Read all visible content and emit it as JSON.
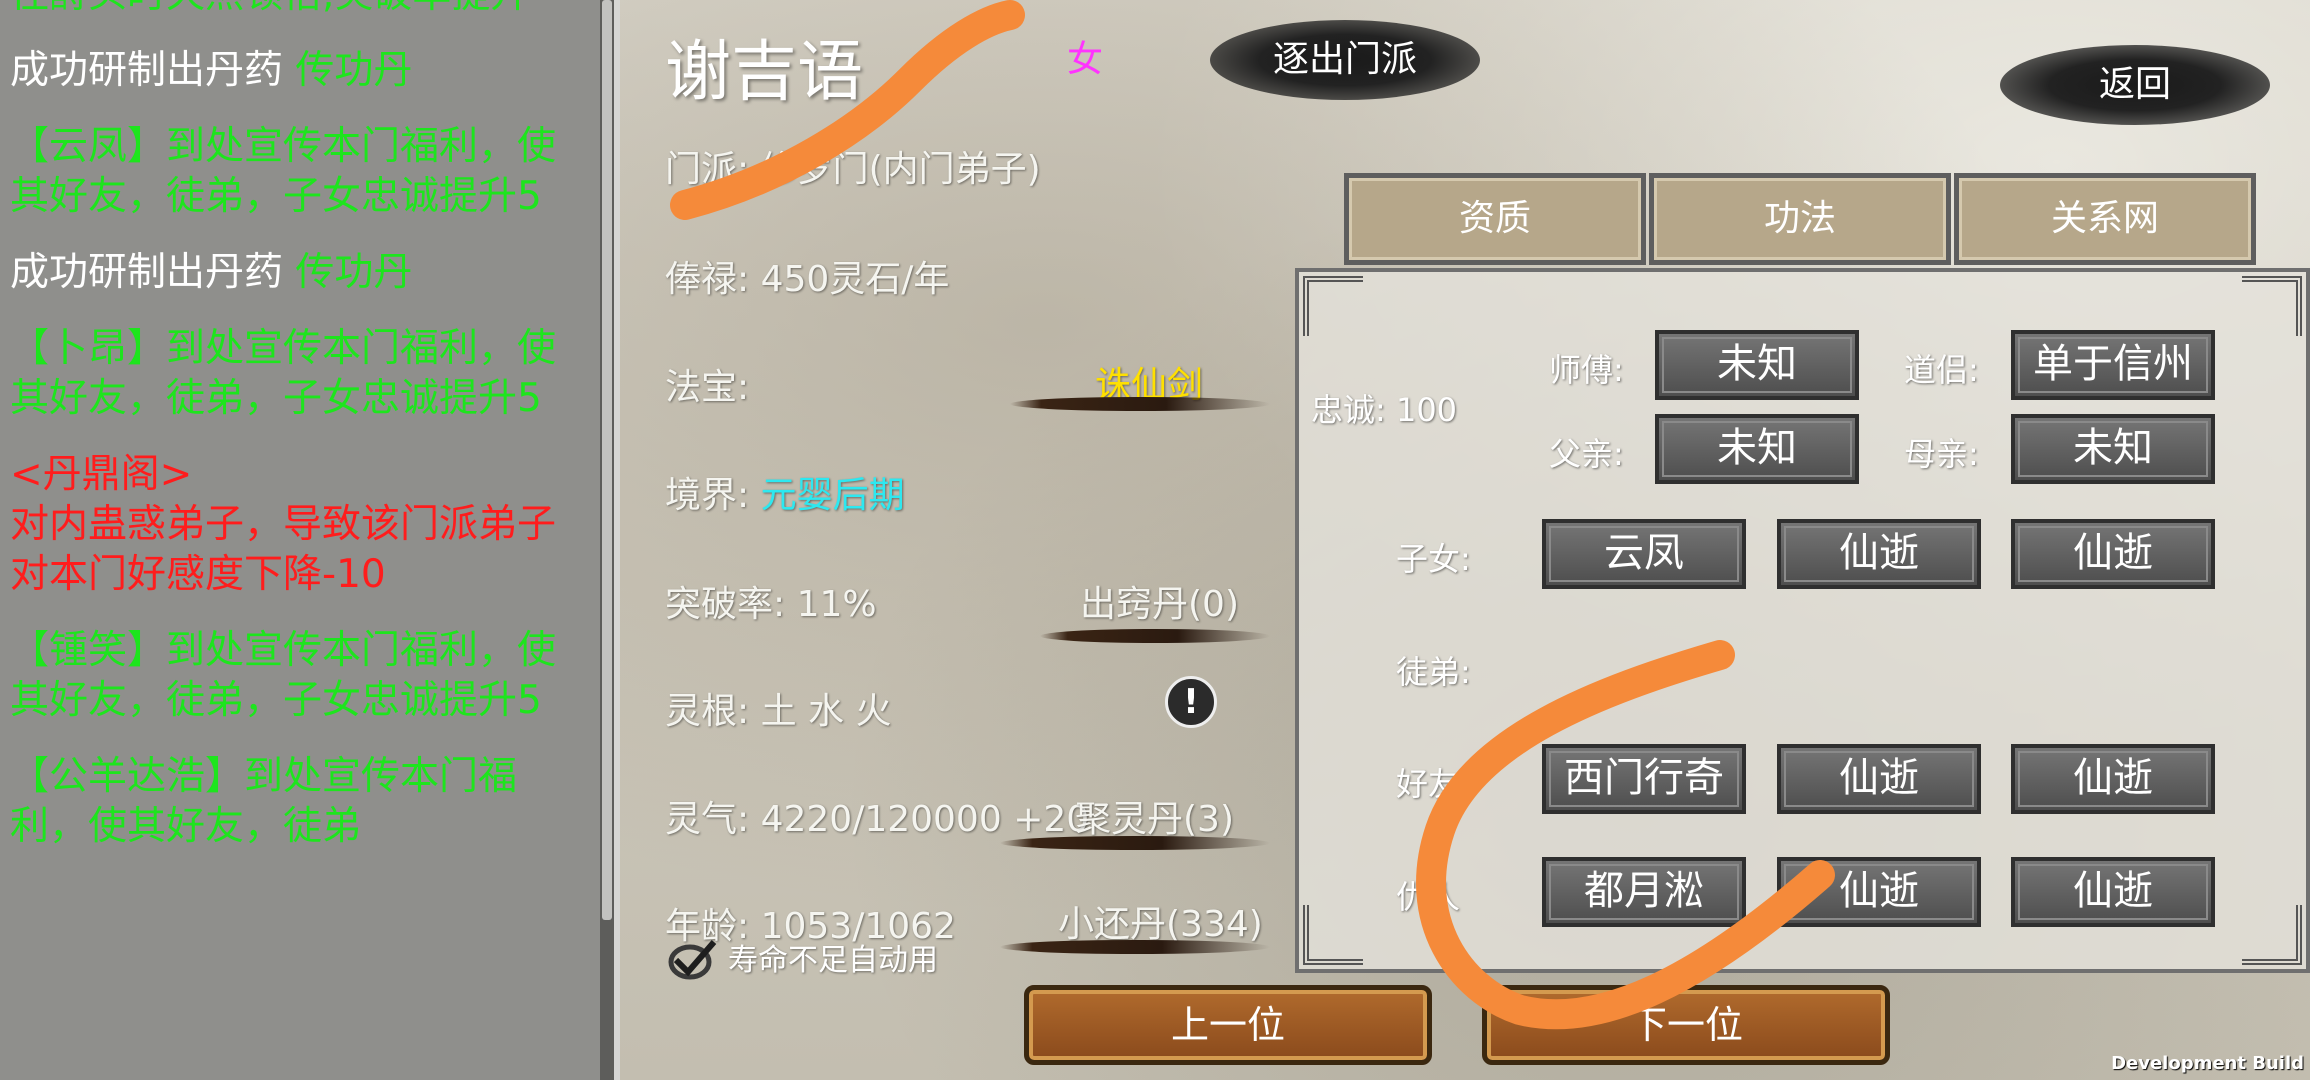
{
  "log": [
    {
      "parts": [
        {
          "text": "往酹头时天然顿悟,突破率提升",
          "color": "green"
        }
      ]
    },
    {
      "parts": [
        {
          "text": "成功研制出丹药 ",
          "color": "white"
        },
        {
          "text": "传功丹",
          "color": "green"
        }
      ]
    },
    {
      "parts": [
        {
          "text": "【云凤】到处宣传本门福利，使其好友，徒弟，子女忠诚提升5",
          "color": "green"
        }
      ]
    },
    {
      "parts": [
        {
          "text": "成功研制出丹药 ",
          "color": "white"
        },
        {
          "text": "传功丹",
          "color": "green"
        }
      ]
    },
    {
      "parts": [
        {
          "text": "【卜昂】到处宣传本门福利，使其好友，徒弟，子女忠诚提升5",
          "color": "green"
        }
      ]
    },
    {
      "parts": [
        {
          "text": "<丹鼎阁>",
          "color": "red"
        },
        {
          "text": "对内蛊惑弟子，导致该门派弟子对本门好感度下降-10",
          "color": "red"
        }
      ]
    },
    {
      "parts": [
        {
          "text": "【锺笑】到处宣传本门福利，使其好友，徒弟，子女忠诚提升5",
          "color": "green"
        }
      ]
    },
    {
      "parts": [
        {
          "text": "【公羊达浩】到处宣传本门福利，使其好友，徒弟",
          "color": "green"
        }
      ]
    }
  ],
  "character": {
    "name": "谢吉语",
    "gender": "女",
    "expel_label": "逐出门派",
    "back_label": "返回",
    "sect_label": "门派: ",
    "sect_value": "修罗门(内门弟子)",
    "salary_label": "俸禄: ",
    "salary_value": "450灵石/年",
    "treasure_label": "法宝:",
    "treasure_value": "诛仙剑",
    "realm_label": "境界: ",
    "realm_value": "元婴后期",
    "breakthrough_label": "突破率:  11%",
    "breakthrough_pill": "出窍丹(0)",
    "root_label": "灵根: 土 水 火",
    "qi_label": "灵气: 4220/120000 +20",
    "qi_pill": "聚灵丹(3)",
    "age_label": "年龄: 1053/1062",
    "age_pill": "小还丹(334)",
    "auto_use_label": "寿命不足自动用"
  },
  "tabs": [
    "资质",
    "功法",
    "关系网"
  ],
  "relations": {
    "loyalty_label": "忠诚: 100",
    "master_label": "师傅:",
    "master_value": "未知",
    "partner_label": "道侣:",
    "partner_value": "单于信州",
    "father_label": "父亲:",
    "father_value": "未知",
    "mother_label": "母亲:",
    "mother_value": "未知",
    "children_label": "子女:",
    "children": [
      "云凤",
      "仙逝",
      "仙逝"
    ],
    "disciples_label": "徒弟:",
    "friends_label": "好友:",
    "friends": [
      "西门行奇",
      "仙逝",
      "仙逝"
    ],
    "enemies_label": "仇人",
    "enemies": [
      "都月淞",
      "仙逝",
      "仙逝"
    ]
  },
  "nav": {
    "prev_label": "上一位",
    "next_label": "下一位"
  },
  "footer": {
    "dev_build": "Development Build"
  },
  "colors": {
    "log_green": "#1de51d",
    "log_red": "#ff1c1c",
    "treasure": "#ffe000",
    "realm": "#2de8f0",
    "gender": "#ff33ff",
    "stroke": "#f58a3a"
  }
}
